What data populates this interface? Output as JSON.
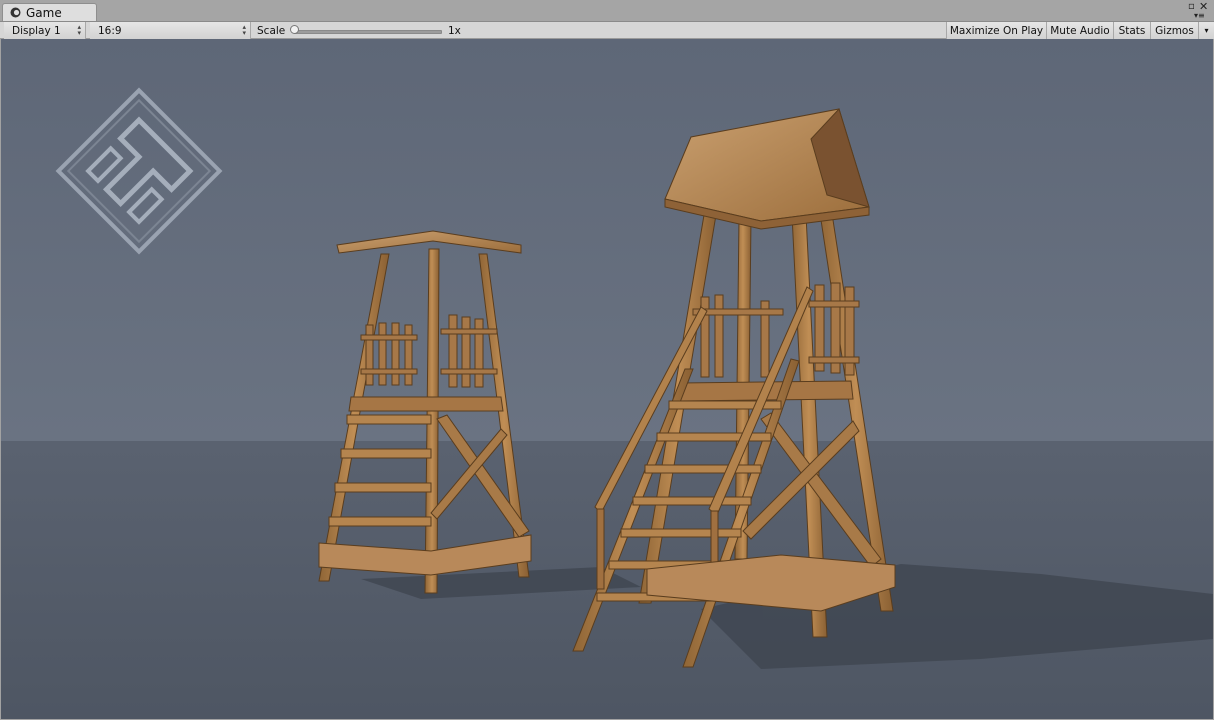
{
  "window": {
    "tab_label": "Game",
    "icon": "unity-game-icon",
    "controls": [
      "maximize-icon",
      "close-icon",
      "panel-menu-icon"
    ]
  },
  "toolbar": {
    "display": "Display 1",
    "aspect": "16:9",
    "scale_label": "Scale",
    "scale_value": "1x",
    "scale_level": 0.0,
    "maximize_on_play": "Maximize On Play",
    "mute_audio": "Mute Audio",
    "stats": "Stats",
    "gizmos": "Gizmos"
  },
  "scene": {
    "sky_color": "#5c6575",
    "ground_color": "#535b69",
    "wood_color": "#b0804a",
    "objects": [
      "logo-watermark",
      "small-watchtower",
      "large-watchtower"
    ]
  }
}
